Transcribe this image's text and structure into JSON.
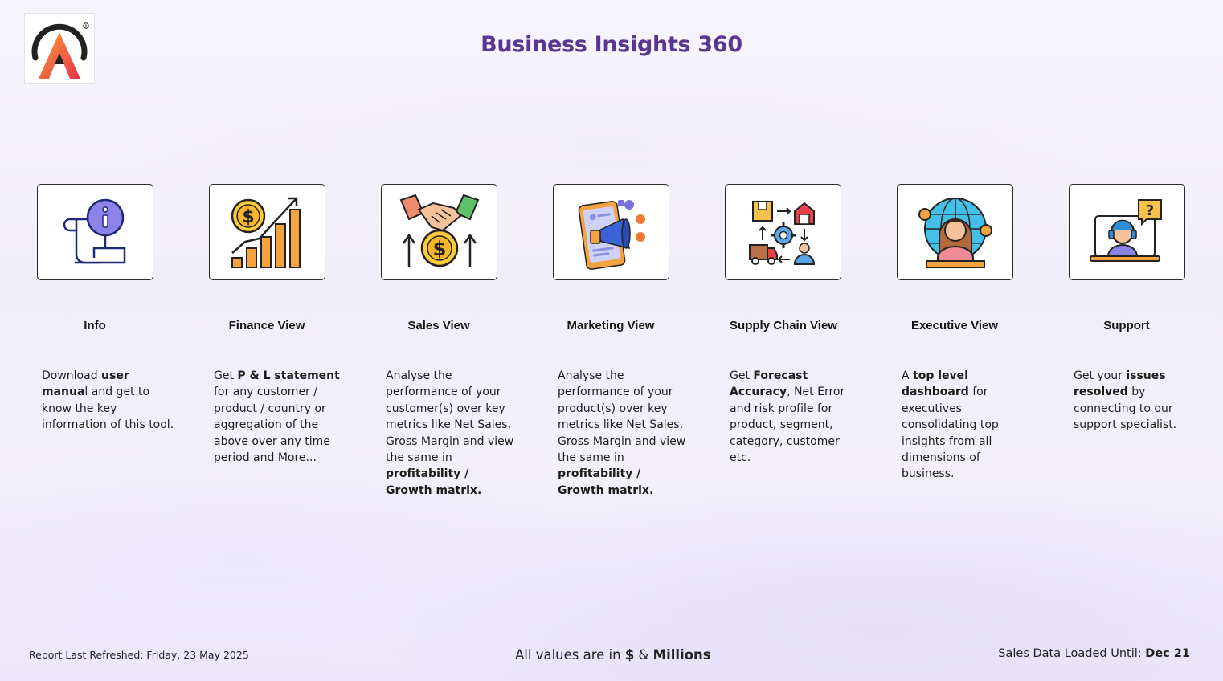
{
  "header": {
    "title": "Business Insights 360"
  },
  "nav_cards": [
    {
      "label": "Info",
      "icon": "info-scroll-icon",
      "description": [
        {
          "text": "Download ",
          "bold": false
        },
        {
          "text": "user manua",
          "bold": true
        },
        {
          "text": "l and get to know the key information of this tool.",
          "bold": false
        }
      ]
    },
    {
      "label": "Finance View",
      "icon": "finance-growth-icon",
      "description": [
        {
          "text": "Get  ",
          "bold": false
        },
        {
          "text": "P & L statement",
          "bold": true
        },
        {
          "text": " for any customer / product / country or aggregation of the above over any time period and More...",
          "bold": false
        }
      ]
    },
    {
      "label": "Sales View",
      "icon": "sales-handshake-icon",
      "description": [
        {
          "text": "Analyse the performance of your customer(s) over key metrics like Net Sales, Gross Margin and view the same in ",
          "bold": false
        },
        {
          "text": "profitability / Growth matrix.",
          "bold": true
        }
      ]
    },
    {
      "label": "Marketing View",
      "icon": "marketing-megaphone-icon",
      "description": [
        {
          "text": "Analyse the performance of your product(s) over key metrics like Net Sales, Gross Margin and view the same in ",
          "bold": false
        },
        {
          "text": "profitability / Growth matrix.",
          "bold": true
        }
      ]
    },
    {
      "label": "Supply Chain View",
      "icon": "supply-chain-icon",
      "description": [
        {
          "text": "Get ",
          "bold": false
        },
        {
          "text": "Forecast Accuracy",
          "bold": true
        },
        {
          "text": ", Net Error and risk profile for product, segment, category, customer etc.",
          "bold": false
        }
      ]
    },
    {
      "label": "Executive View",
      "icon": "executive-globe-icon",
      "description": [
        {
          "text": "A ",
          "bold": false
        },
        {
          "text": "top level dashboard",
          "bold": true
        },
        {
          "text": " for executives consolidating top insights from all dimensions of business.",
          "bold": false
        }
      ]
    },
    {
      "label": "Support",
      "icon": "support-agent-icon",
      "description": [
        {
          "text": "Get your ",
          "bold": false
        },
        {
          "text": "issues resolved",
          "bold": true
        },
        {
          "text": " by connecting to our support specialist.",
          "bold": false
        }
      ]
    }
  ],
  "footer": {
    "refreshed": "Report Last Refreshed: Friday, 23 May 2025",
    "values_prefix": "All values are in ",
    "values_currency": "$",
    "values_amp": " & ",
    "values_unit": "Millions",
    "loaded_prefix": "Sales Data Loaded Until: ",
    "loaded_value": "Dec 21"
  }
}
